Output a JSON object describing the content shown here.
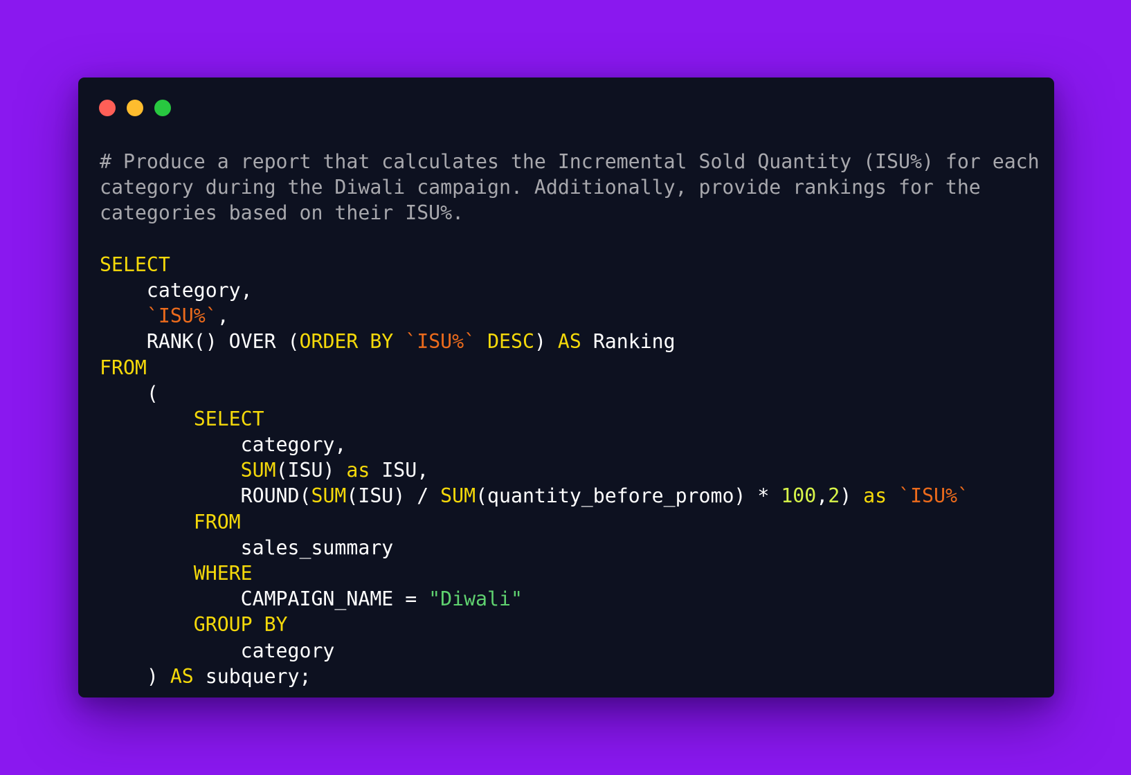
{
  "window": {
    "controls": [
      "close",
      "minimize",
      "maximize"
    ]
  },
  "colors": {
    "background": "#8a18ef",
    "editor_background": "#0d1120",
    "comment": "#a8a8ad",
    "keyword": "#f5d90a",
    "backtick_identifier": "#ec6b1c",
    "string": "#5fd16f",
    "number": "#d8f54a",
    "text": "#ffffff"
  },
  "code": {
    "comment": [
      "# Produce a report that calculates the Incremental Sold Quantity (ISU%) for each",
      "category during the Diwali campaign. Additionally, provide rankings for the",
      "categories based on their ISU%."
    ],
    "lines": [
      [
        {
          "t": "kw",
          "v": "SELECT"
        }
      ],
      [
        {
          "t": "plain",
          "v": "    category,"
        }
      ],
      [
        {
          "t": "bt",
          "v": "    `ISU%`"
        },
        {
          "t": "plain",
          "v": ","
        }
      ],
      [
        {
          "t": "plain",
          "v": "    RANK() OVER ("
        },
        {
          "t": "kw",
          "v": "ORDER BY"
        },
        {
          "t": "plain",
          "v": " "
        },
        {
          "t": "bt",
          "v": "`ISU%`"
        },
        {
          "t": "plain",
          "v": " "
        },
        {
          "t": "kw",
          "v": "DESC"
        },
        {
          "t": "plain",
          "v": ") "
        },
        {
          "t": "kw",
          "v": "AS"
        },
        {
          "t": "plain",
          "v": " Ranking"
        }
      ],
      [
        {
          "t": "kw",
          "v": "FROM"
        }
      ],
      [
        {
          "t": "plain",
          "v": "    ("
        }
      ],
      [
        {
          "t": "kw",
          "v": "        SELECT"
        }
      ],
      [
        {
          "t": "plain",
          "v": "            category,"
        }
      ],
      [
        {
          "t": "kw",
          "v": "            SUM"
        },
        {
          "t": "plain",
          "v": "(ISU) "
        },
        {
          "t": "kw",
          "v": "as"
        },
        {
          "t": "plain",
          "v": " ISU,"
        }
      ],
      [
        {
          "t": "plain",
          "v": "            ROUND("
        },
        {
          "t": "kw",
          "v": "SUM"
        },
        {
          "t": "plain",
          "v": "(ISU) / "
        },
        {
          "t": "kw",
          "v": "SUM"
        },
        {
          "t": "plain",
          "v": "(quantity_before_promo) * "
        },
        {
          "t": "num",
          "v": "100"
        },
        {
          "t": "plain",
          "v": ","
        },
        {
          "t": "num",
          "v": "2"
        },
        {
          "t": "plain",
          "v": ") "
        },
        {
          "t": "kw",
          "v": "as"
        },
        {
          "t": "plain",
          "v": " "
        },
        {
          "t": "bt",
          "v": "`ISU%`"
        }
      ],
      [
        {
          "t": "kw",
          "v": "        FROM"
        }
      ],
      [
        {
          "t": "plain",
          "v": "            sales_summary"
        }
      ],
      [
        {
          "t": "kw",
          "v": "        WHERE"
        }
      ],
      [
        {
          "t": "plain",
          "v": "            CAMPAIGN_NAME = "
        },
        {
          "t": "str",
          "v": "\"Diwali\""
        }
      ],
      [
        {
          "t": "kw",
          "v": "        GROUP BY"
        }
      ],
      [
        {
          "t": "plain",
          "v": "            category"
        }
      ],
      [
        {
          "t": "plain",
          "v": "    ) "
        },
        {
          "t": "kw",
          "v": "AS"
        },
        {
          "t": "plain",
          "v": " subquery;"
        }
      ]
    ]
  }
}
